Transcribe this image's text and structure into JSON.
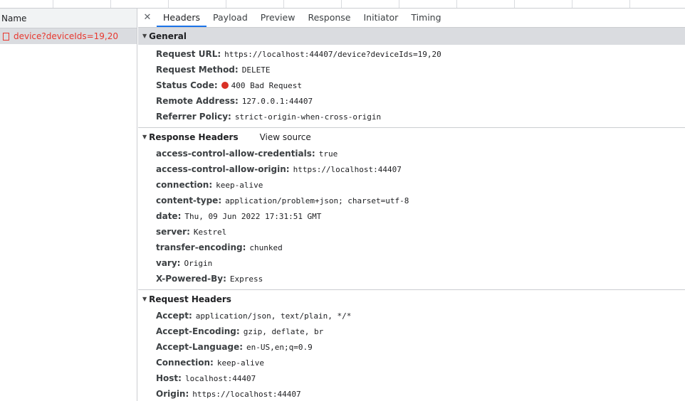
{
  "name_column": "Name",
  "request": {
    "name": "device?deviceIds=19,20"
  },
  "tabs": [
    "Headers",
    "Payload",
    "Preview",
    "Response",
    "Initiator",
    "Timing"
  ],
  "close_symbol": "✕",
  "general": {
    "title": "General",
    "rows": [
      {
        "k": "Request URL:",
        "v": "https://localhost:44407/device?deviceIds=19,20"
      },
      {
        "k": "Request Method:",
        "v": "DELETE"
      },
      {
        "k": "Status Code:",
        "v": "400 Bad Request"
      },
      {
        "k": "Remote Address:",
        "v": "127.0.0.1:44407"
      },
      {
        "k": "Referrer Policy:",
        "v": "strict-origin-when-cross-origin"
      }
    ]
  },
  "response_headers": {
    "title": "Response Headers",
    "view_source": "View source",
    "rows": [
      {
        "k": "access-control-allow-credentials:",
        "v": "true"
      },
      {
        "k": "access-control-allow-origin:",
        "v": "https://localhost:44407"
      },
      {
        "k": "connection:",
        "v": "keep-alive"
      },
      {
        "k": "content-type:",
        "v": "application/problem+json; charset=utf-8"
      },
      {
        "k": "date:",
        "v": "Thu, 09 Jun 2022 17:31:51 GMT"
      },
      {
        "k": "server:",
        "v": "Kestrel"
      },
      {
        "k": "transfer-encoding:",
        "v": "chunked"
      },
      {
        "k": "vary:",
        "v": "Origin"
      },
      {
        "k": "X-Powered-By:",
        "v": "Express"
      }
    ]
  },
  "request_headers": {
    "title": "Request Headers",
    "rows": [
      {
        "k": "Accept:",
        "v": "application/json, text/plain, */*"
      },
      {
        "k": "Accept-Encoding:",
        "v": "gzip, deflate, br"
      },
      {
        "k": "Accept-Language:",
        "v": "en-US,en;q=0.9"
      },
      {
        "k": "Connection:",
        "v": "keep-alive"
      },
      {
        "k": "Host:",
        "v": "localhost:44407"
      },
      {
        "k": "Origin:",
        "v": "https://localhost:44407"
      }
    ]
  },
  "colors": {
    "error": "#e8372e",
    "accent": "#1a73e8",
    "status_dot": "#d93025"
  }
}
